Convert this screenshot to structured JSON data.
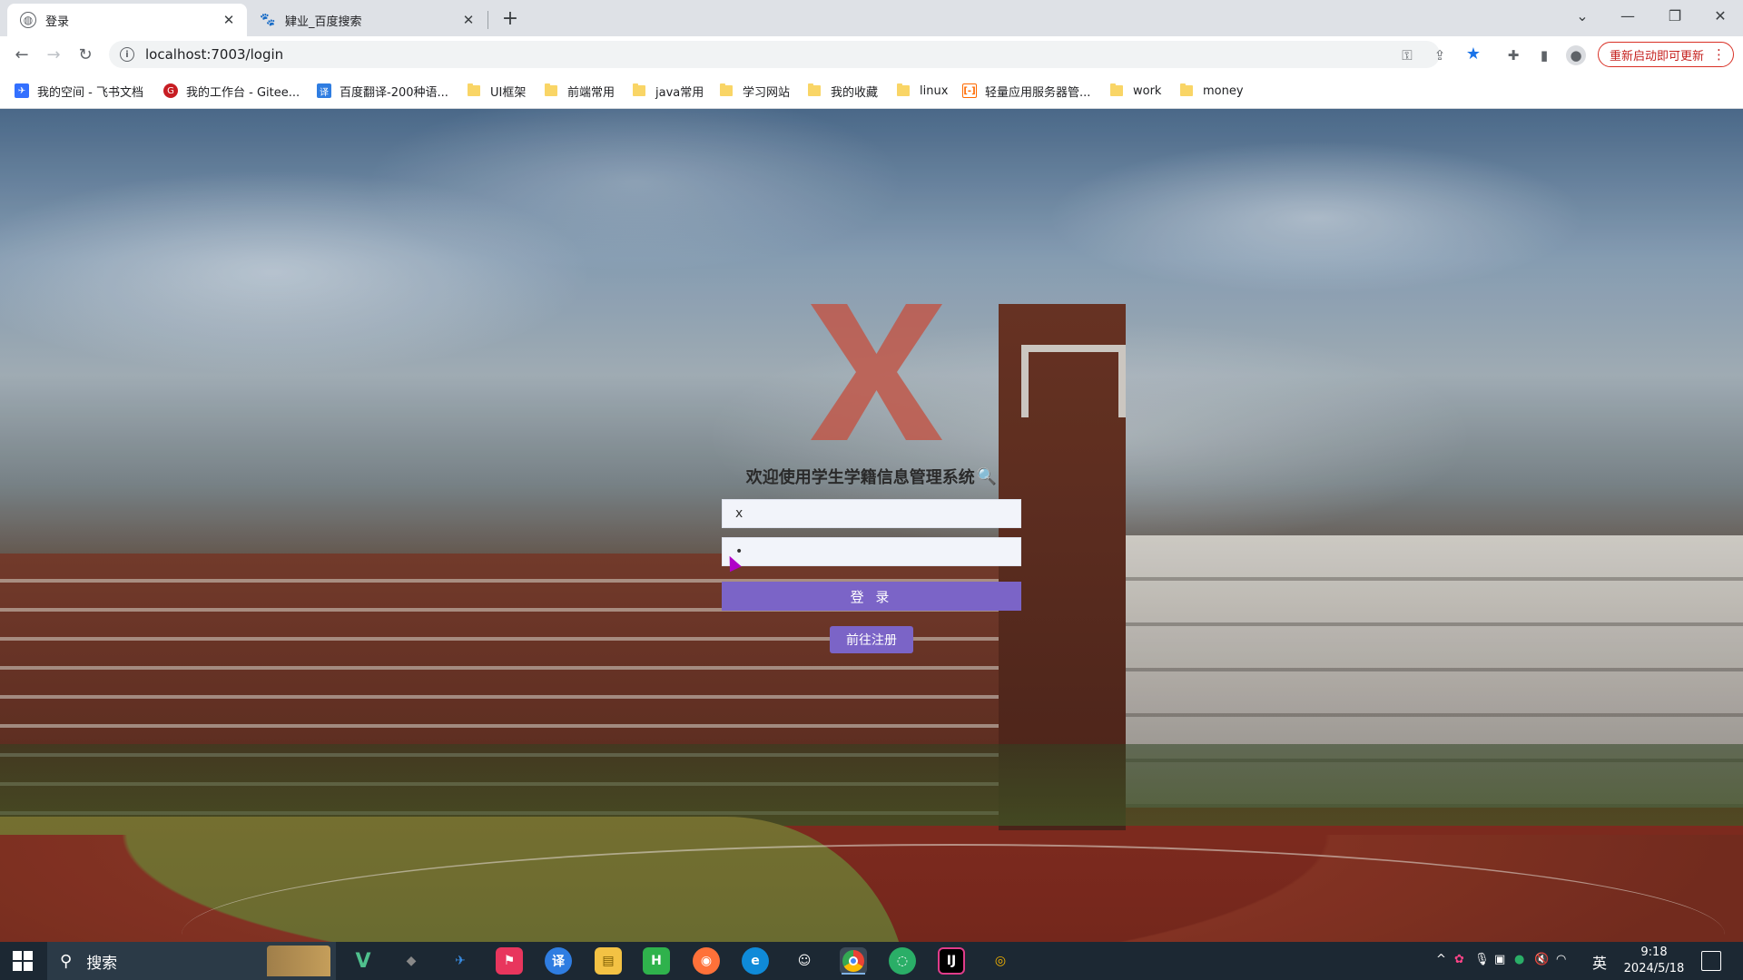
{
  "browser": {
    "tabs": [
      {
        "title": "登录",
        "active": true
      },
      {
        "title": "肄业_百度搜索",
        "active": false
      }
    ],
    "address": "localhost:7003/login",
    "update_button": "重新启动即可更新",
    "bookmarks": [
      {
        "label": "我的空间 - 飞书文档",
        "kind": "site"
      },
      {
        "label": "我的工作台 - Gitee...",
        "kind": "site"
      },
      {
        "label": "百度翻译-200种语...",
        "kind": "site"
      },
      {
        "label": "UI框架",
        "kind": "folder"
      },
      {
        "label": "前端常用",
        "kind": "folder"
      },
      {
        "label": "java常用",
        "kind": "folder"
      },
      {
        "label": "学习网站",
        "kind": "folder"
      },
      {
        "label": "我的收藏",
        "kind": "folder"
      },
      {
        "label": "linux",
        "kind": "folder"
      },
      {
        "label": "轻量应用服务器管...",
        "kind": "site"
      },
      {
        "label": "work",
        "kind": "folder"
      },
      {
        "label": "money",
        "kind": "folder"
      }
    ]
  },
  "login": {
    "title": "欢迎使用学生学籍信息管理系统",
    "username_value": "x",
    "password_value": "•",
    "login_button": "登 录",
    "register_button": "前往注册",
    "button_color": "#7b64c7"
  },
  "taskbar": {
    "search_label": "搜索",
    "ime": "英",
    "time": "9:18",
    "date": "2024/5/18"
  }
}
